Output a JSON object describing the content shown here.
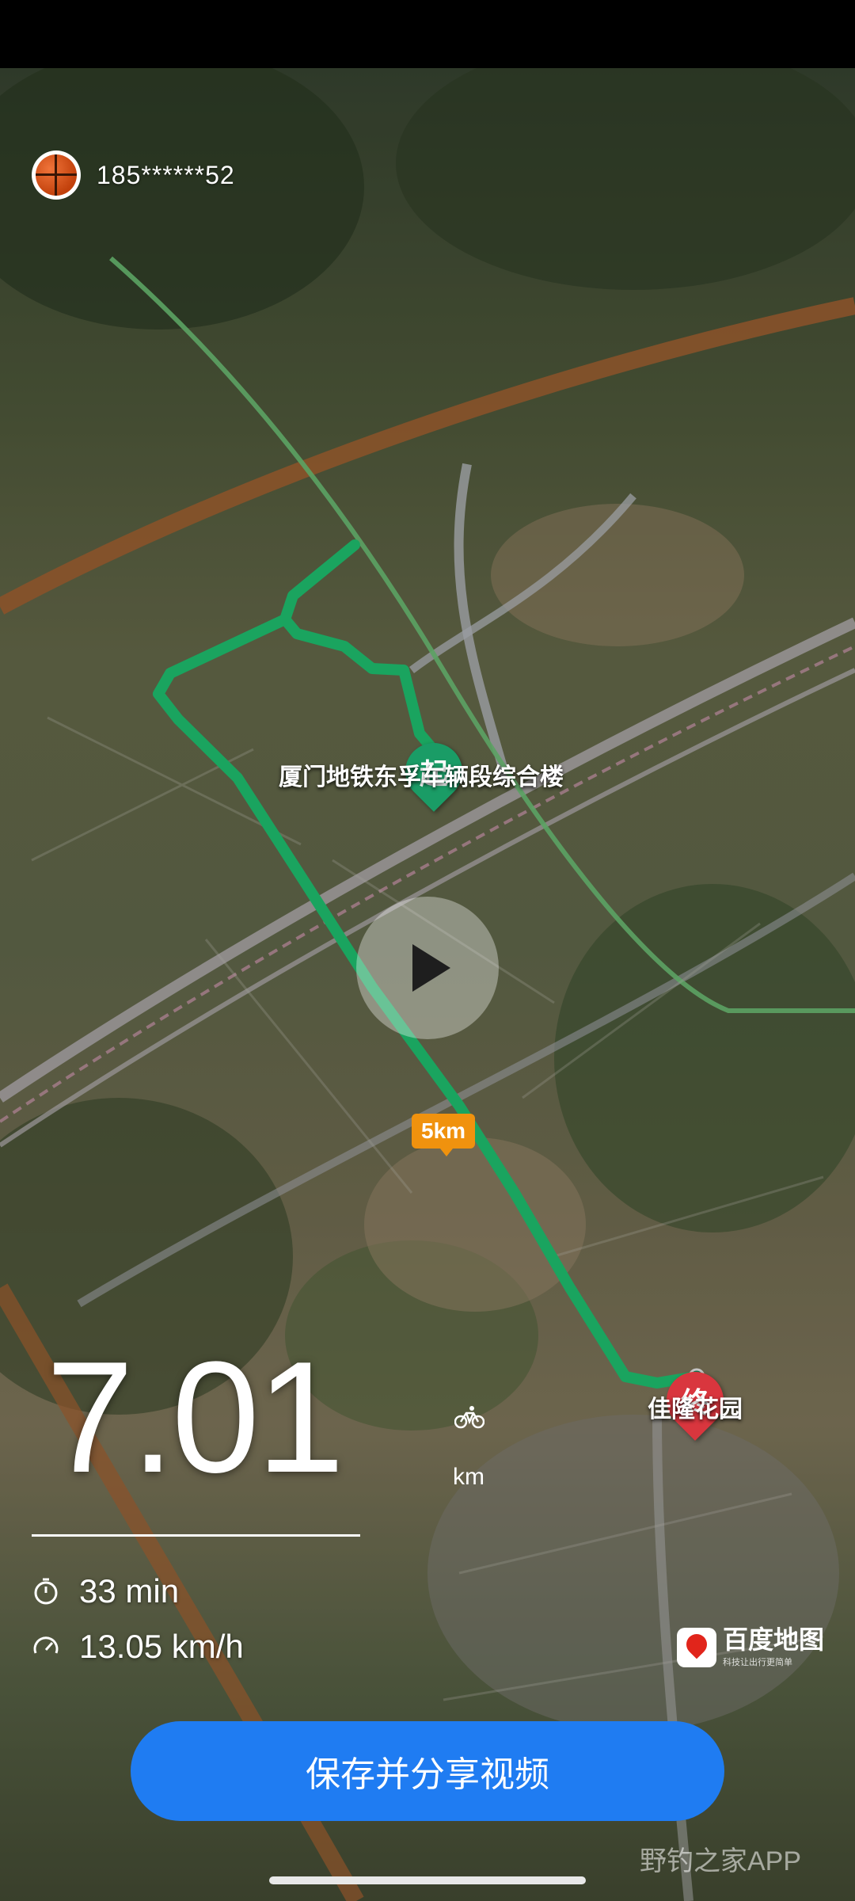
{
  "user": {
    "phone": "185******52",
    "avatar_icon": "basketball-icon"
  },
  "map": {
    "start_marker": "起",
    "start_label": "厦门地铁东孚车辆段综合楼",
    "end_marker": "终",
    "end_label": "佳隆花园",
    "km_marker": "5km",
    "route_color": "#22d27a",
    "provider_name": "百度地图",
    "provider_tagline": "科技让出行更简单"
  },
  "stats": {
    "distance": "7.01",
    "distance_unit": "km",
    "activity_icon": "bicycle-icon",
    "duration": "33 min",
    "speed": "13.05 km/h"
  },
  "actions": {
    "share_label": "保存并分享视频"
  },
  "watermark": "野钓之家APP",
  "colors": {
    "button_blue": "#1f7cf2",
    "start_green": "#1a9c66",
    "end_red": "#d9363e",
    "km_orange": "#f0920e"
  }
}
